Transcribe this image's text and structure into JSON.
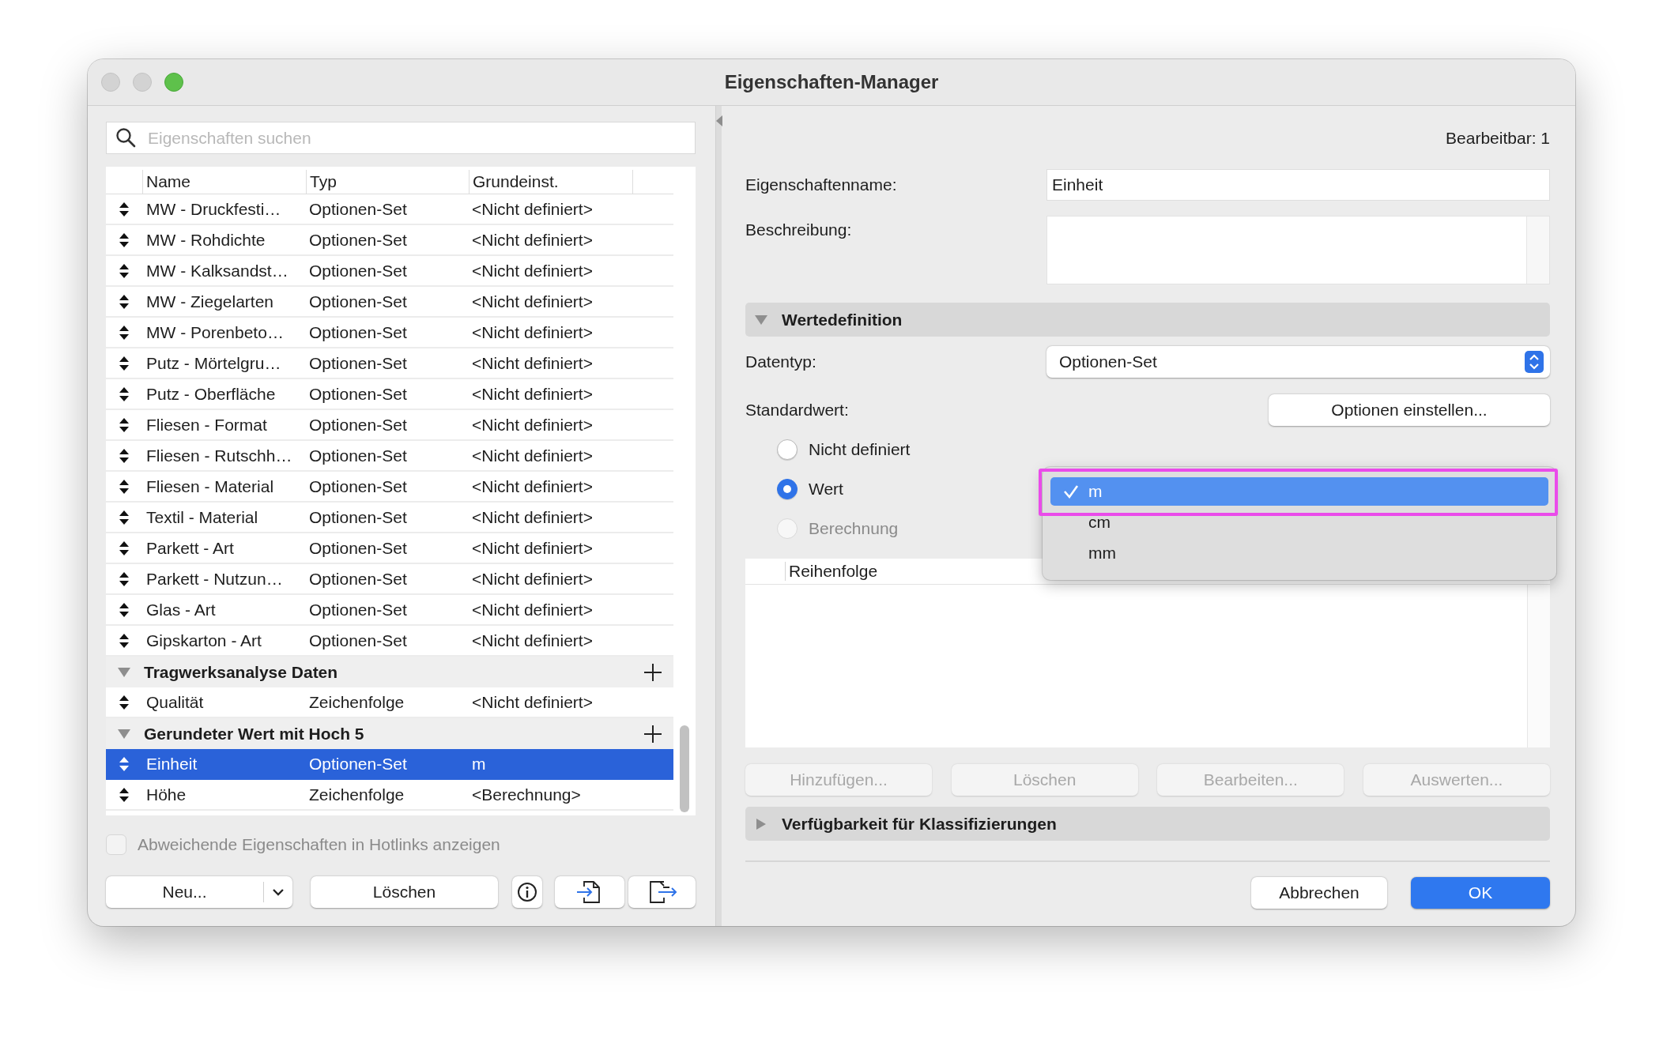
{
  "window": {
    "title": "Eigenschaften-Manager"
  },
  "search": {
    "placeholder": "Eigenschaften suchen"
  },
  "table": {
    "columns": [
      "Name",
      "Typ",
      "Grundeinst."
    ],
    "rows": [
      {
        "kind": "property",
        "name": "MW - Druckfesti…",
        "type": "Optionen-Set",
        "default": "<Nicht definiert>",
        "selected": false
      },
      {
        "kind": "property",
        "name": "MW - Rohdichte",
        "type": "Optionen-Set",
        "default": "<Nicht definiert>",
        "selected": false
      },
      {
        "kind": "property",
        "name": "MW - Kalksandst…",
        "type": "Optionen-Set",
        "default": "<Nicht definiert>",
        "selected": false
      },
      {
        "kind": "property",
        "name": "MW - Ziegelarten",
        "type": "Optionen-Set",
        "default": "<Nicht definiert>",
        "selected": false
      },
      {
        "kind": "property",
        "name": "MW - Porenbeto…",
        "type": "Optionen-Set",
        "default": "<Nicht definiert>",
        "selected": false
      },
      {
        "kind": "property",
        "name": "Putz - Mörtelgru…",
        "type": "Optionen-Set",
        "default": "<Nicht definiert>",
        "selected": false
      },
      {
        "kind": "property",
        "name": "Putz - Oberfläche",
        "type": "Optionen-Set",
        "default": "<Nicht definiert>",
        "selected": false
      },
      {
        "kind": "property",
        "name": "Fliesen - Format",
        "type": "Optionen-Set",
        "default": "<Nicht definiert>",
        "selected": false
      },
      {
        "kind": "property",
        "name": "Fliesen - Rutschh…",
        "type": "Optionen-Set",
        "default": "<Nicht definiert>",
        "selected": false
      },
      {
        "kind": "property",
        "name": "Fliesen - Material",
        "type": "Optionen-Set",
        "default": "<Nicht definiert>",
        "selected": false
      },
      {
        "kind": "property",
        "name": "Textil - Material",
        "type": "Optionen-Set",
        "default": "<Nicht definiert>",
        "selected": false
      },
      {
        "kind": "property",
        "name": "Parkett - Art",
        "type": "Optionen-Set",
        "default": "<Nicht definiert>",
        "selected": false
      },
      {
        "kind": "property",
        "name": "Parkett - Nutzun…",
        "type": "Optionen-Set",
        "default": "<Nicht definiert>",
        "selected": false
      },
      {
        "kind": "property",
        "name": "Glas - Art",
        "type": "Optionen-Set",
        "default": "<Nicht definiert>",
        "selected": false
      },
      {
        "kind": "property",
        "name": "Gipskarton - Art",
        "type": "Optionen-Set",
        "default": "<Nicht definiert>",
        "selected": false
      },
      {
        "kind": "group",
        "name": "Tragwerksanalyse Daten",
        "expanded": true,
        "children": [
          {
            "kind": "property",
            "name": "Qualität",
            "type": "Zeichenfolge",
            "default": "<Nicht definiert>",
            "selected": false
          }
        ]
      },
      {
        "kind": "group",
        "name": "Gerundeter Wert mit Hoch 5",
        "expanded": true,
        "children": [
          {
            "kind": "property",
            "name": "Einheit",
            "type": "Optionen-Set",
            "default": "m",
            "selected": true
          },
          {
            "kind": "property",
            "name": "Höhe",
            "type": "Zeichenfolge",
            "default": "<Berechnung>",
            "selected": false
          }
        ]
      }
    ]
  },
  "hotlinks_checkbox": {
    "label": "Abweichende Eigenschaften in Hotlinks anzeigen",
    "checked": false,
    "disabled": true
  },
  "left_buttons": [
    {
      "kind": "split",
      "label": "Neu..."
    },
    {
      "kind": "text",
      "label": "Löschen"
    },
    {
      "kind": "info"
    },
    {
      "kind": "import"
    },
    {
      "kind": "export"
    }
  ],
  "editable_count": "Bearbeitbar: 1",
  "name_field": {
    "label": "Eigenschaftenname:",
    "value": "Einheit"
  },
  "description_field": {
    "label": "Beschreibung:"
  },
  "value_section": {
    "title": "Wertedefinition",
    "expanded": true
  },
  "datatype": {
    "label": "Datentyp:",
    "value": "Optionen-Set"
  },
  "default_value": {
    "label": "Standardwert:",
    "button": "Optionen einstellen...",
    "options": [
      {
        "label": "Nicht definiert",
        "selected": false,
        "disabled": false
      },
      {
        "label": "Wert",
        "selected": true,
        "disabled": false
      },
      {
        "label": "Berechnung",
        "selected": false,
        "disabled": true
      }
    ]
  },
  "value_menu": {
    "items": [
      {
        "label": "m",
        "selected": true,
        "annotated": true
      },
      {
        "label": "cm",
        "selected": false,
        "annotated": false
      },
      {
        "label": "mm",
        "selected": false,
        "annotated": false
      }
    ]
  },
  "order_list": {
    "columns": [
      "Reihenfolge"
    ]
  },
  "list_buttons": [
    {
      "label": "Hinzufügen...",
      "disabled": true
    },
    {
      "label": "Löschen",
      "disabled": true
    },
    {
      "label": "Bearbeiten...",
      "disabled": true
    },
    {
      "label": "Auswerten...",
      "disabled": true
    }
  ],
  "availability_section": {
    "title": "Verfügbarkeit für Klassifizierungen",
    "expanded": false
  },
  "dialog_buttons": [
    {
      "label": "Abbrechen",
      "kind": "default"
    },
    {
      "label": "OK",
      "kind": "primary"
    }
  ]
}
